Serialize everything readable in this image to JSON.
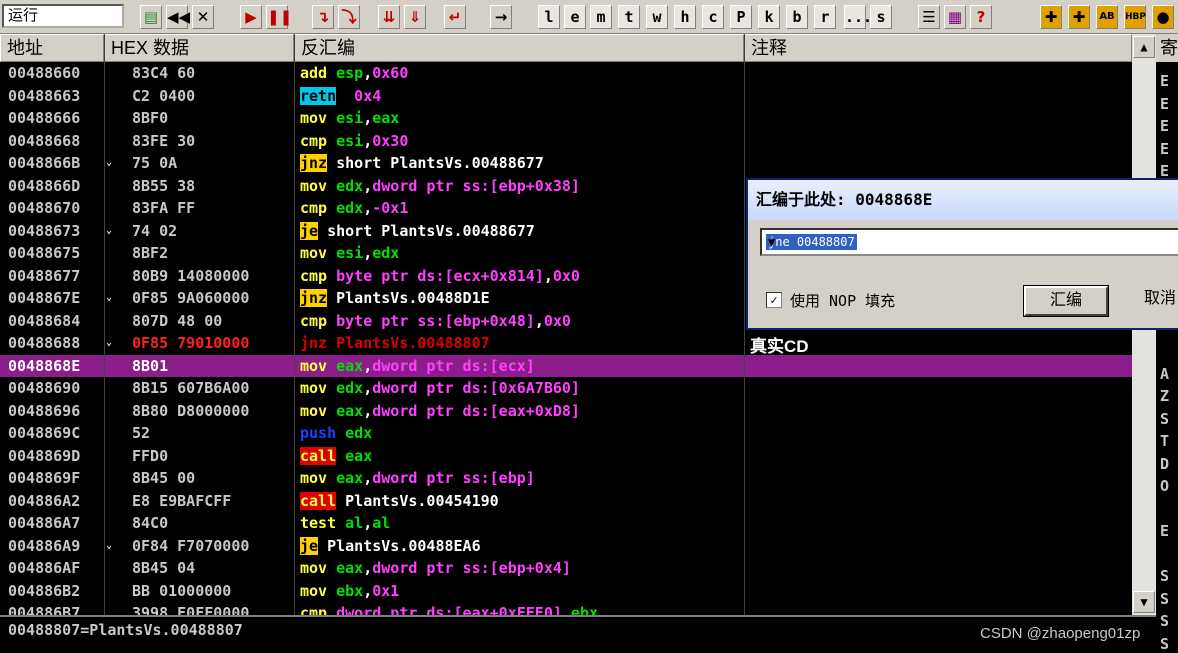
{
  "toolbar": {
    "state": "运行",
    "letters": [
      "l",
      "e",
      "m",
      "t",
      "w",
      "h",
      "c",
      "P",
      "k",
      "b",
      "r",
      "...",
      "s"
    ]
  },
  "columns": {
    "address": "地址",
    "hex": "HEX 数据",
    "disasm": "反汇编",
    "comment": "注释"
  },
  "rows": [
    {
      "addr": "00488660",
      "mark": "",
      "hex": "83C4 60",
      "op": "add",
      "opc": "o-add",
      "args": [
        [
          "esp",
          "rg"
        ],
        [
          ",",
          "tx"
        ],
        [
          "0x60",
          "nm"
        ]
      ]
    },
    {
      "addr": "00488663",
      "mark": "",
      "hex": "C2 0400",
      "op": "retn",
      "opc": "o-retn",
      "args": [
        [
          " 0x4",
          "nm"
        ]
      ]
    },
    {
      "addr": "00488666",
      "mark": "",
      "hex": "8BF0",
      "op": "mov",
      "opc": "o-mov",
      "args": [
        [
          "esi",
          "rg"
        ],
        [
          ",",
          "tx"
        ],
        [
          "eax",
          "rg"
        ]
      ]
    },
    {
      "addr": "00488668",
      "mark": "",
      "hex": "83FE 30",
      "op": "cmp",
      "opc": "o-cmp",
      "args": [
        [
          "esi",
          "rg"
        ],
        [
          ",",
          "tx"
        ],
        [
          "0x30",
          "nm"
        ]
      ]
    },
    {
      "addr": "0048866B",
      "mark": "⌄",
      "hex": "75 0A",
      "op": "jnz",
      "opc": "o-jmp",
      "args": [
        [
          "short PlantsVs.00488677",
          "tx"
        ]
      ]
    },
    {
      "addr": "0048866D",
      "mark": "",
      "hex": "8B55 38",
      "op": "mov",
      "opc": "o-mov",
      "args": [
        [
          "edx",
          "rg"
        ],
        [
          ",",
          "tx"
        ],
        [
          "dword ptr ss:[ebp+0x38]",
          "mm"
        ]
      ]
    },
    {
      "addr": "00488670",
      "mark": "",
      "hex": "83FA FF",
      "op": "cmp",
      "opc": "o-cmp",
      "args": [
        [
          "edx",
          "rg"
        ],
        [
          ",",
          "tx"
        ],
        [
          "-0x1",
          "nm"
        ]
      ]
    },
    {
      "addr": "00488673",
      "mark": "⌄",
      "hex": "74 02",
      "op": "je",
      "opc": "o-jmp",
      "args": [
        [
          "short PlantsVs.00488677",
          "tx"
        ]
      ]
    },
    {
      "addr": "00488675",
      "mark": "",
      "hex": "8BF2",
      "op": "mov",
      "opc": "o-mov",
      "args": [
        [
          "esi",
          "rg"
        ],
        [
          ",",
          "tx"
        ],
        [
          "edx",
          "rg"
        ]
      ]
    },
    {
      "addr": "00488677",
      "mark": "",
      "hex": "80B9 14080000",
      "op": "cmp",
      "opc": "o-cmp",
      "args": [
        [
          "byte ptr ds:[ecx+0x814]",
          "mm"
        ],
        [
          ",",
          "tx"
        ],
        [
          "0x0",
          "nm"
        ]
      ]
    },
    {
      "addr": "0048867E",
      "mark": "⌄",
      "hex": "0F85 9A060000",
      "op": "jnz",
      "opc": "o-jmp",
      "args": [
        [
          "PlantsVs.00488D1E",
          "tx"
        ]
      ]
    },
    {
      "addr": "00488684",
      "mark": "",
      "hex": "807D 48 00",
      "op": "cmp",
      "opc": "o-cmp",
      "args": [
        [
          "byte ptr ss:[ebp+0x48]",
          "mm"
        ],
        [
          ",",
          "tx"
        ],
        [
          "0x0",
          "nm"
        ]
      ]
    },
    {
      "addr": "00488688",
      "mark": "⌄",
      "hex": "0F85 79010000",
      "op": "jnz",
      "opc": "o-jmp",
      "args": [
        [
          "PlantsVs.00488807",
          "tx"
        ]
      ],
      "cls": "tgt",
      "comment": "真实CD"
    },
    {
      "addr": "0048868E",
      "mark": "",
      "hex": "8B01",
      "op": "mov",
      "opc": "o-mov",
      "args": [
        [
          "eax",
          "rg"
        ],
        [
          ",",
          "tx"
        ],
        [
          "dword ptr ds:[ecx]",
          "mm"
        ]
      ],
      "cls": "sel"
    },
    {
      "addr": "00488690",
      "mark": "",
      "hex": "8B15 607B6A00",
      "op": "mov",
      "opc": "o-mov",
      "args": [
        [
          "edx",
          "rg"
        ],
        [
          ",",
          "tx"
        ],
        [
          "dword ptr ds:[0x6A7B60]",
          "mm"
        ]
      ]
    },
    {
      "addr": "00488696",
      "mark": "",
      "hex": "8B80 D8000000",
      "op": "mov",
      "opc": "o-mov",
      "args": [
        [
          "eax",
          "rg"
        ],
        [
          ",",
          "tx"
        ],
        [
          "dword ptr ds:[eax+0xD8]",
          "mm"
        ]
      ]
    },
    {
      "addr": "0048869C",
      "mark": "",
      "hex": "52",
      "op": "push",
      "opc": "o-push",
      "args": [
        [
          "edx",
          "rg"
        ]
      ]
    },
    {
      "addr": "0048869D",
      "mark": "",
      "hex": "FFD0",
      "op": "call",
      "opc": "o-call",
      "args": [
        [
          "eax",
          "rg"
        ]
      ]
    },
    {
      "addr": "0048869F",
      "mark": "",
      "hex": "8B45 00",
      "op": "mov",
      "opc": "o-mov",
      "args": [
        [
          "eax",
          "rg"
        ],
        [
          ",",
          "tx"
        ],
        [
          "dword ptr ss:[ebp]",
          "mm"
        ]
      ]
    },
    {
      "addr": "004886A2",
      "mark": "",
      "hex": "E8 E9BAFCFF",
      "op": "call",
      "opc": "o-call",
      "args": [
        [
          "PlantsVs.00454190",
          "tx"
        ]
      ]
    },
    {
      "addr": "004886A7",
      "mark": "",
      "hex": "84C0",
      "op": "test",
      "opc": "o-test",
      "args": [
        [
          "al",
          "rg"
        ],
        [
          ",",
          "tx"
        ],
        [
          "al",
          "rg"
        ]
      ]
    },
    {
      "addr": "004886A9",
      "mark": "⌄",
      "hex": "0F84 F7070000",
      "op": "je",
      "opc": "o-jmp",
      "args": [
        [
          "PlantsVs.00488EA6",
          "tx"
        ]
      ]
    },
    {
      "addr": "004886AF",
      "mark": "",
      "hex": "8B45 04",
      "op": "mov",
      "opc": "o-mov",
      "args": [
        [
          "eax",
          "rg"
        ],
        [
          ",",
          "tx"
        ],
        [
          "dword ptr ss:[ebp+0x4]",
          "mm"
        ]
      ]
    },
    {
      "addr": "004886B2",
      "mark": "",
      "hex": "BB 01000000",
      "op": "mov",
      "opc": "o-mov",
      "args": [
        [
          "ebx",
          "rg"
        ],
        [
          ",",
          "tx"
        ],
        [
          "0x1",
          "nm"
        ]
      ]
    },
    {
      "addr": "004886B7",
      "mark": "",
      "hex": "3998 E0FF0000",
      "op": "cmp",
      "opc": "o-cmp",
      "args": [
        [
          "dword ptr ds:[eax+0xFFE0]",
          "mm"
        ],
        [
          ",",
          "tx"
        ],
        [
          "ebx",
          "rg"
        ]
      ]
    }
  ],
  "regs_partial": [
    "E",
    "E",
    "E",
    "E",
    "E",
    "",
    "",
    "",
    "",
    "",
    "",
    "",
    "",
    "A",
    "Z",
    "S",
    "T",
    "D",
    "O",
    "",
    "E",
    "",
    "S",
    "S",
    "S",
    "S",
    "S"
  ],
  "dialog": {
    "title": "汇编于此处: 0048868E",
    "input": "jne 00488807",
    "checkbox": "使用 NOP 填充",
    "ok": "汇编",
    "cancel": "取消"
  },
  "status": "00488807=PlantsVs.00488807",
  "watermark": "CSDN @zhaopeng01zp"
}
